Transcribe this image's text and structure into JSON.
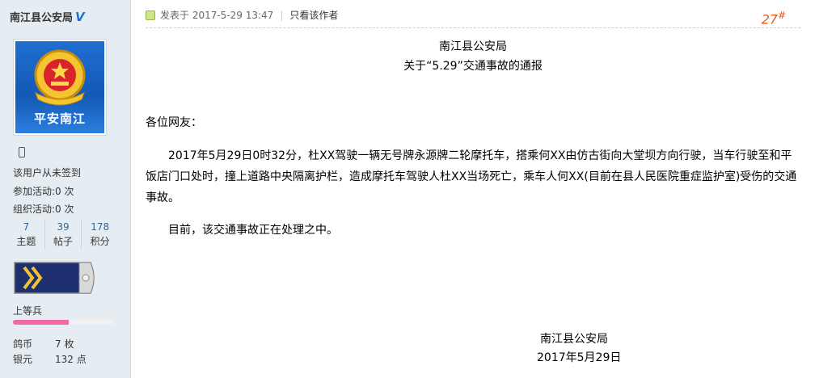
{
  "user": {
    "name": "南江县公安局",
    "verified_badge": "V",
    "avatar_text": "平安南江",
    "signin": "该用户从未签到",
    "activities_joined": "参加活动:0 次",
    "activities_organized": "组织活动:0 次",
    "stats": [
      {
        "value": "7",
        "label": "主题"
      },
      {
        "value": "39",
        "label": "帖子"
      },
      {
        "value": "178",
        "label": "积分"
      }
    ],
    "rank": "上等兵",
    "rank_progress": 0.55,
    "currency": [
      {
        "key": "鸽币",
        "value": "7 枚"
      },
      {
        "key": "银元",
        "value": "132 点"
      }
    ]
  },
  "post": {
    "posted_at": "发表于 2017-5-29 13:47",
    "only_author": "只看该作者",
    "floor": "27",
    "floor_mark": "#",
    "heading1": "南江县公安局",
    "heading2": "关于“5.29”交通事故的通报",
    "greeting": "各位网友：",
    "body": "2017年5月29日0时32分，杜XX驾驶一辆无号牌永源牌二轮摩托车，搭乘何XX由仿古街向大堂坝方向行驶，当车行驶至和平饭店门口处时，撞上道路中央隔离护栏，造成摩托车驾驶人杜XX当场死亡，乘车人何XX(目前在县人民医院重症监护室)受伤的交通事故。",
    "status": "目前，该交通事故正在处理之中。",
    "signature": "南江县公安局",
    "date": "2017年5月29日"
  },
  "colors": {
    "sidebar_bg": "#e5edf2",
    "floor": "#e35d14",
    "badge": "#1e6fd6",
    "progress": "#f06aa5"
  }
}
